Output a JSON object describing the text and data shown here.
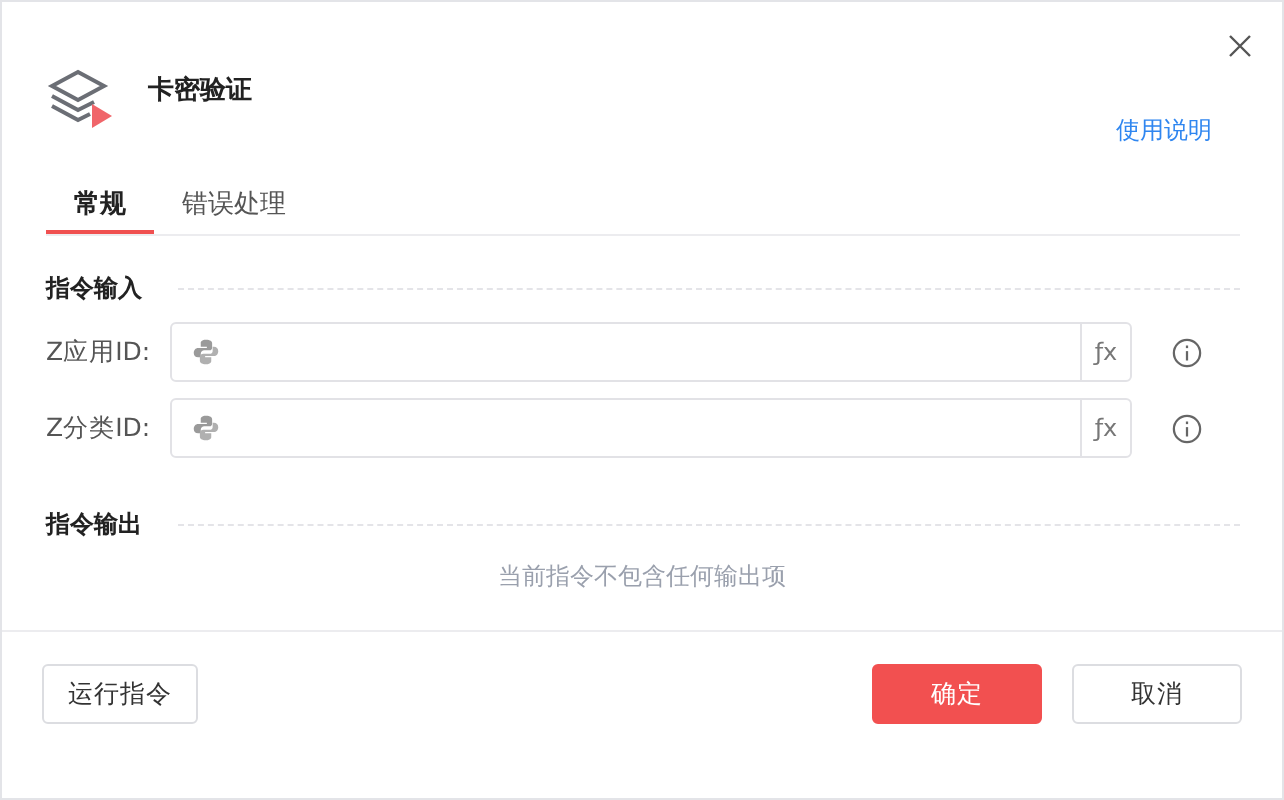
{
  "dialog": {
    "title": "卡密验证",
    "help_link": "使用说明"
  },
  "tabs": [
    {
      "label": "常规",
      "selected": true
    },
    {
      "label": "错误处理",
      "selected": false
    }
  ],
  "input_section": {
    "title": "指令输入",
    "fields": [
      {
        "label": "Z应用ID:",
        "formula_button": "ƒx"
      },
      {
        "label": "Z分类ID:",
        "formula_button": "ƒx"
      }
    ]
  },
  "output_section": {
    "title": "指令输出",
    "empty_text": "当前指令不包含任何输出项"
  },
  "footer_buttons": [
    {
      "label": "运行指令",
      "kind": "secondary"
    },
    {
      "label": "确定",
      "kind": "primary"
    },
    {
      "label": "取消",
      "kind": "secondary"
    }
  ]
}
